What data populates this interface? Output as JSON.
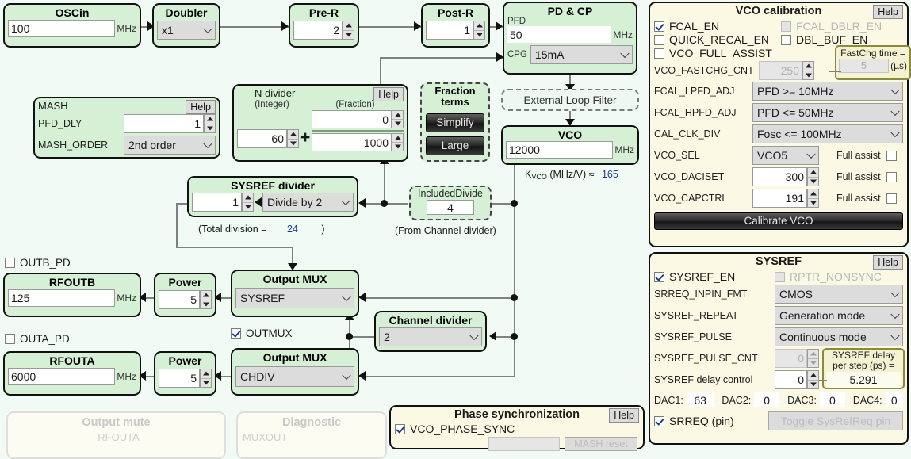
{
  "blocks": {
    "oscin": {
      "title": "OSCin",
      "value": "100",
      "unit": "MHz"
    },
    "doubler": {
      "title": "Doubler",
      "value": "x1"
    },
    "prer": {
      "title": "Pre-R",
      "value": "2"
    },
    "postr": {
      "title": "Post-R",
      "value": "1"
    },
    "pdcp": {
      "title": "PD & CP",
      "pfd_label": "PFD",
      "pfd_value": "50",
      "pfd_unit": "MHz",
      "cpg_label": "CPG",
      "cpg_value": "15mA"
    },
    "mash": {
      "title": "MASH",
      "help": "Help",
      "pfd_dly_label": "PFD_DLY",
      "pfd_dly_value": "1",
      "mash_order_label": "MASH_ORDER",
      "mash_order_value": "2nd order"
    },
    "ndiv": {
      "title": "N divider",
      "help": "Help",
      "integer_label": "(Integer)",
      "fraction_label": "(Fraction)",
      "integer_value": "60",
      "num_value": "0",
      "den_value": "1000",
      "plus": "+"
    },
    "fraction_terms": {
      "title_line1": "Fraction",
      "title_line2": "terms",
      "simplify": "Simplify",
      "large": "Large"
    },
    "loopfilter": {
      "label": "External Loop Filter"
    },
    "vco": {
      "title": "VCO",
      "value": "12000",
      "unit": "MHz",
      "kvco_label": "K",
      "kvco_sub": "VCO",
      "kvco_rest": " (MHz/V) ≈",
      "kvco_value": "165"
    },
    "sysref_div": {
      "title": "SYSREF divider",
      "value": "1",
      "mode": "Divide by 2",
      "total_label": "(Total division =",
      "total_value": "24",
      "total_close": ")"
    },
    "included_divide": {
      "title": "IncludedDivide",
      "value": "4",
      "caption": "(From Channel divider)"
    },
    "chdiv": {
      "title": "Channel divider",
      "value": "2"
    },
    "outb_pd": {
      "label": "OUTB_PD",
      "checked": false
    },
    "outa_pd": {
      "label": "OUTA_PD",
      "checked": false
    },
    "rfoutb": {
      "title": "RFOUTB",
      "value": "125",
      "unit": "MHz"
    },
    "rfouta": {
      "title": "RFOUTA",
      "value": "6000",
      "unit": "MHz"
    },
    "powerb": {
      "title": "Power",
      "value": "5"
    },
    "powera": {
      "title": "Power",
      "value": "5"
    },
    "muxb": {
      "title": "Output MUX",
      "value": "SYSREF"
    },
    "muxa": {
      "title": "Output MUX",
      "value": "CHDIV"
    },
    "outmux": {
      "label": "OUTMUX",
      "checked": true
    }
  },
  "vco_calibration": {
    "title": "VCO calibration",
    "help": "Help",
    "fcal_en": {
      "label": "FCAL_EN",
      "checked": true,
      "disabled": false
    },
    "fcal_dblr_en": {
      "label": "FCAL_DBLR_EN",
      "checked": false,
      "disabled": true
    },
    "quick_recal_en": {
      "label": "QUICK_RECAL_EN",
      "checked": false,
      "disabled": false
    },
    "dbl_buf_en": {
      "label": "DBL_BUF_EN",
      "checked": false,
      "disabled": false
    },
    "vco_full_assist": {
      "label": "VCO_FULL_ASSIST",
      "checked": false,
      "disabled": false
    },
    "fastchg_cnt": {
      "label": "VCO_FASTCHG_CNT",
      "value": "250",
      "disabled": true
    },
    "fastchg_callout": {
      "label": "FastChg time =",
      "value": "5",
      "unit": "(µs)"
    },
    "fcal_lpfd_adj": {
      "label": "FCAL_LPFD_ADJ",
      "value": "PFD >= 10MHz"
    },
    "fcal_hpfd_adj": {
      "label": "FCAL_HPFD_ADJ",
      "value": "PFD <= 50MHz"
    },
    "cal_clk_div": {
      "label": "CAL_CLK_DIV",
      "value": "Fosc <= 100MHz"
    },
    "vco_sel": {
      "label": "VCO_SEL",
      "value": "VCO5",
      "assist_label": "Full assist",
      "assist_checked": false
    },
    "vco_daciset": {
      "label": "VCO_DACISET",
      "value": "300",
      "assist_label": "Full assist",
      "assist_checked": false
    },
    "vco_capctrl": {
      "label": "VCO_CAPCTRL",
      "value": "191",
      "assist_label": "Full assist",
      "assist_checked": false
    },
    "calibrate_button": "Calibrate VCO"
  },
  "sysref": {
    "title": "SYSREF",
    "help": "Help",
    "sysref_en": {
      "label": "SYSREF_EN",
      "checked": true,
      "disabled": false
    },
    "rptr_nonsync": {
      "label": "RPTR_NONSYNC",
      "checked": false,
      "disabled": true
    },
    "srreq_inpin_fmt": {
      "label": "SRREQ_INPIN_FMT",
      "value": "CMOS"
    },
    "sysref_repeat": {
      "label": "SYSREF_REPEAT",
      "value": "Generation mode"
    },
    "sysref_pulse": {
      "label": "SYSREF_PULSE",
      "value": "Continuous mode"
    },
    "sysref_pulse_cnt": {
      "label": "SYSREF_PULSE_CNT",
      "value": "0",
      "disabled": true
    },
    "sysref_delay_control": {
      "label": "SYSREF delay control",
      "value": "0"
    },
    "delay_callout": {
      "line1": "SYSREF delay",
      "line2": "per step (ps) =",
      "value": "5.291"
    },
    "dacs": [
      {
        "label": "DAC1:",
        "value": "63"
      },
      {
        "label": "DAC2:",
        "value": "0"
      },
      {
        "label": "DAC3:",
        "value": "0"
      },
      {
        "label": "DAC4:",
        "value": "0"
      }
    ],
    "srreq_pin": {
      "label": "SRREQ (pin)",
      "checked": true
    },
    "toggle_button": "Toggle SysRefReq pin"
  },
  "bottom": {
    "output_mute": {
      "title": "Output mute",
      "sub": "RFOUTA"
    },
    "diagnostic": {
      "title": "Diagnostic",
      "sub": "MUXOUT"
    },
    "phase_sync": {
      "title": "Phase synchronization",
      "help": "Help",
      "vco_phase_sync": {
        "label": "VCO_PHASE_SYNC",
        "checked": true
      },
      "mash_reset": "MASH reset"
    }
  },
  "colors": {
    "block_fill": "#d6f0d6",
    "panel_fill": "#fbf8e3",
    "canvas": "#f2faf6",
    "accent_value": "#1b3d8f",
    "wire": "#808080"
  }
}
